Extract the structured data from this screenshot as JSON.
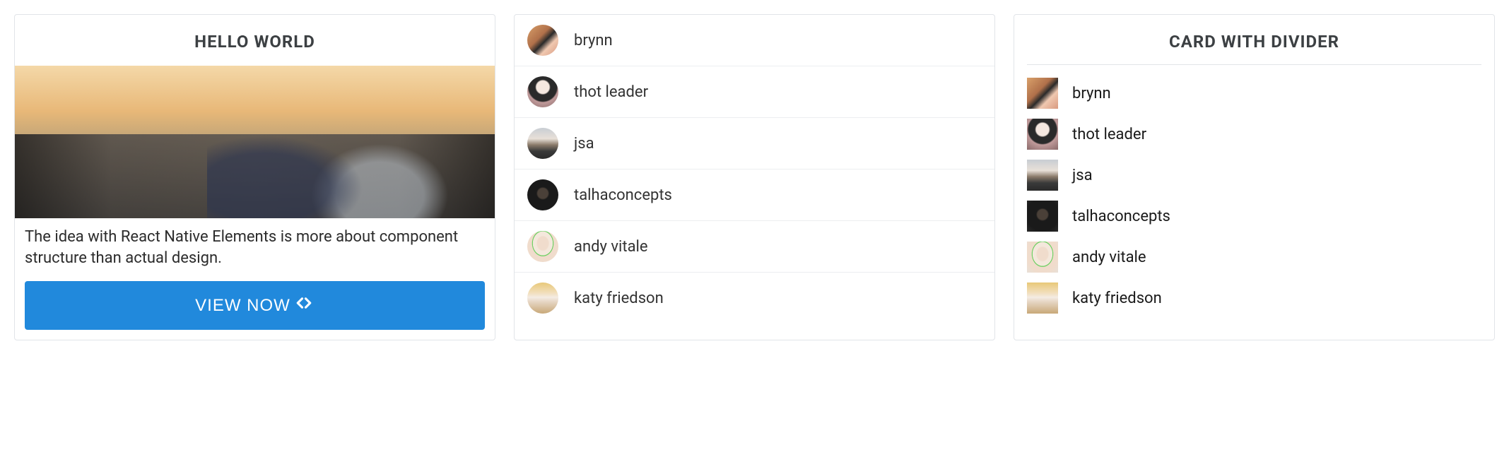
{
  "card1": {
    "title": "HELLO WORLD",
    "description": "The idea with React Native Elements is more about component structure than actual design.",
    "button_label": "VIEW NOW"
  },
  "card2": {
    "users": [
      {
        "name": "brynn"
      },
      {
        "name": "thot leader"
      },
      {
        "name": "jsa"
      },
      {
        "name": "talhaconcepts"
      },
      {
        "name": "andy vitale"
      },
      {
        "name": "katy friedson"
      }
    ]
  },
  "card3": {
    "title": "CARD WITH DIVIDER",
    "users": [
      {
        "name": "brynn"
      },
      {
        "name": "thot leader"
      },
      {
        "name": "jsa"
      },
      {
        "name": "talhaconcepts"
      },
      {
        "name": "andy vitale"
      },
      {
        "name": "katy friedson"
      }
    ]
  }
}
